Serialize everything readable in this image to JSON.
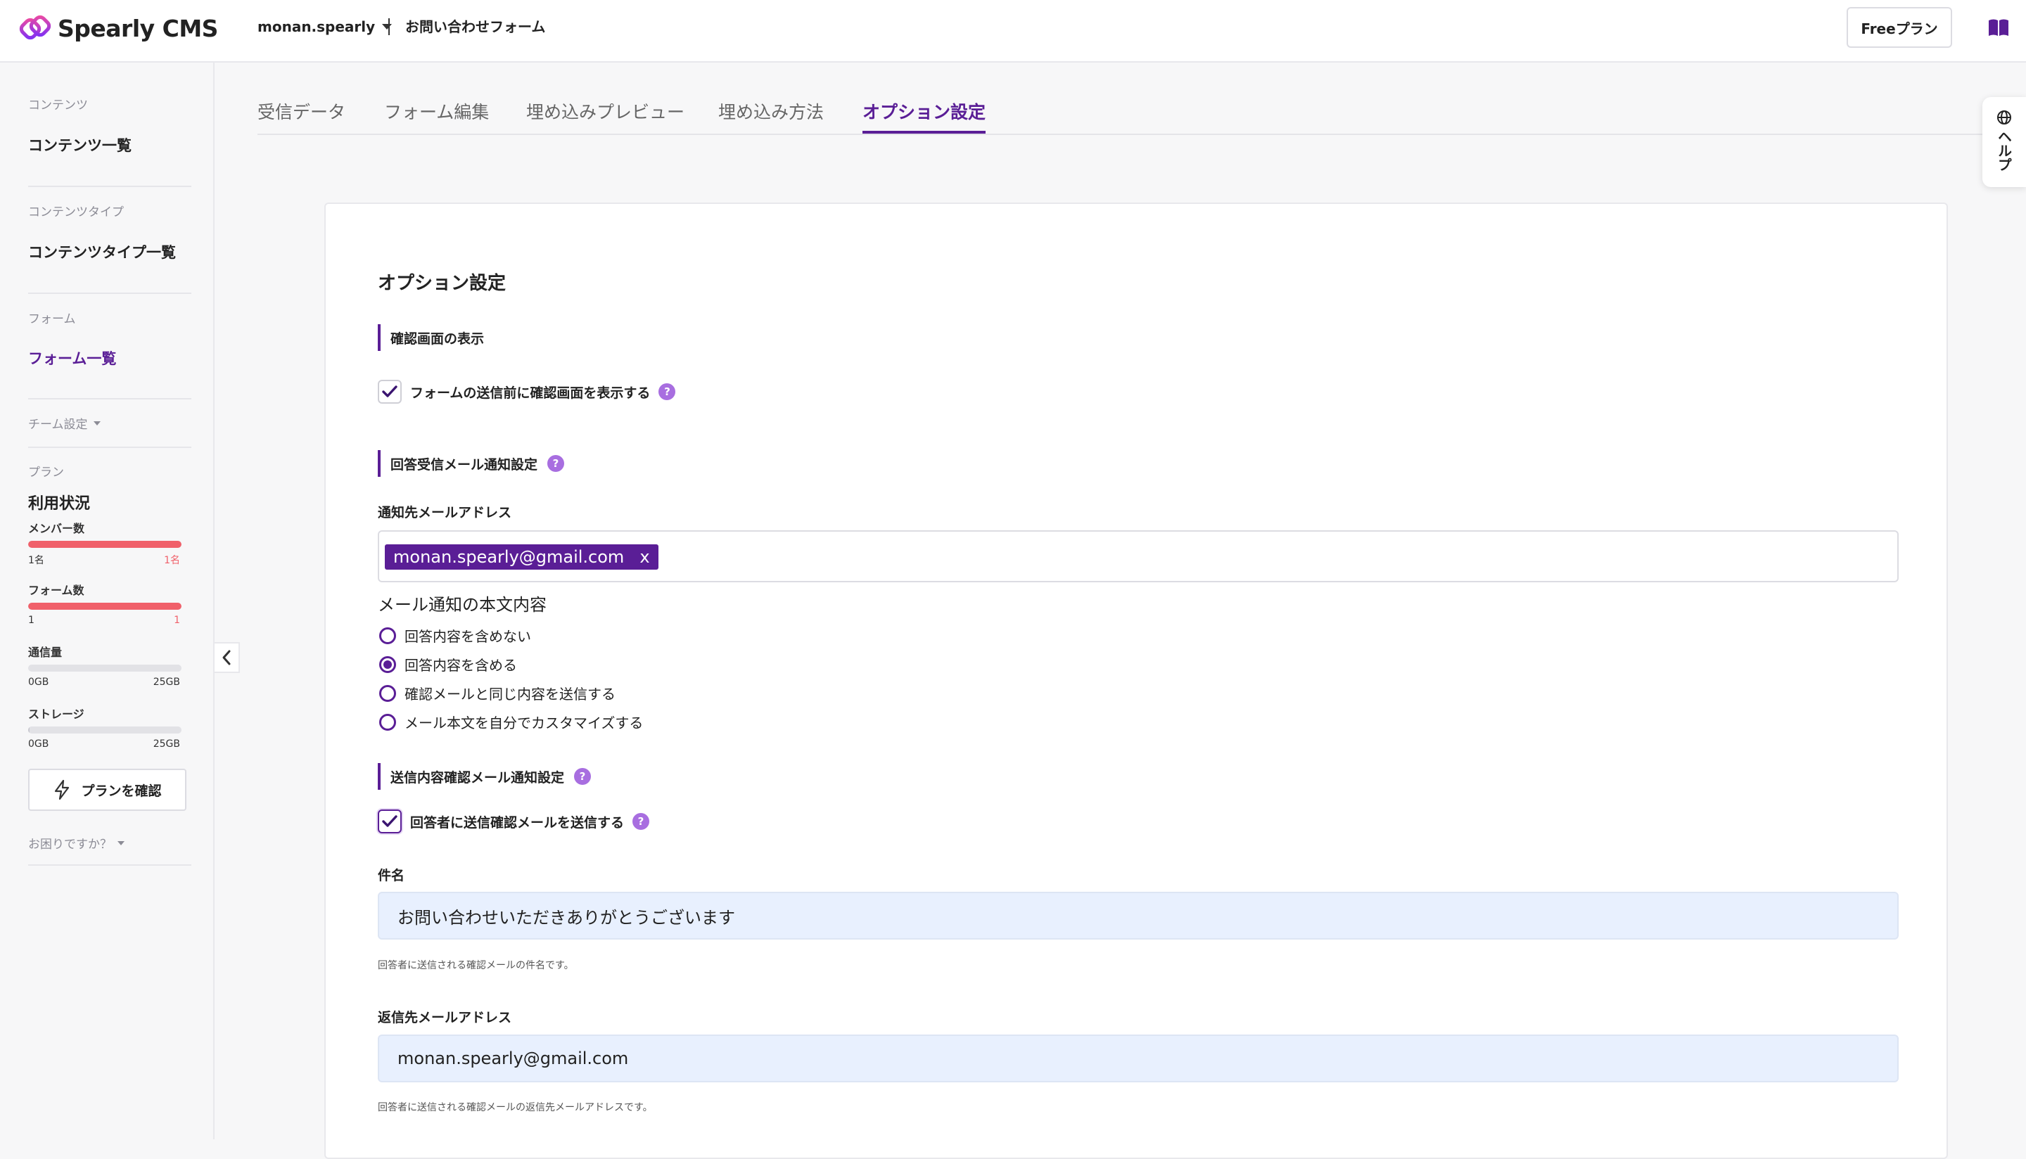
{
  "header": {
    "app_name": "Spearly CMS",
    "team_name": "monan.spearly",
    "form_name": "お問い合わせフォーム",
    "plan_button": "Freeプラン"
  },
  "sidebar": {
    "content_category": "コンテンツ",
    "content_list": "コンテンツ一覧",
    "type_category": "コンテンツタイプ",
    "type_list": "コンテンツタイプ一覧",
    "form_category": "フォーム",
    "form_list": "フォーム一覧",
    "team_settings": "チーム設定",
    "plan_category": "プラン",
    "usage_title": "利用状況",
    "usage": [
      {
        "label": "メンバー数",
        "min": "1名",
        "max": "1名",
        "fill_percent": 100
      },
      {
        "label": "フォーム数",
        "min": "1",
        "max": "1",
        "fill_percent": 100
      },
      {
        "label": "通信量",
        "min": "0GB",
        "max": "25GB",
        "fill_percent": 0
      },
      {
        "label": "ストレージ",
        "min": "0GB",
        "max": "25GB",
        "fill_percent": 1
      }
    ],
    "plan_check_button": "プランを確認",
    "help_dropdown": "お困りですか？"
  },
  "tabs": [
    {
      "label": "受信データ",
      "active": false
    },
    {
      "label": "フォーム編集",
      "active": false
    },
    {
      "label": "埋め込みプレビュー",
      "active": false
    },
    {
      "label": "埋め込み方法",
      "active": false
    },
    {
      "label": "オプション設定",
      "active": true
    }
  ],
  "help_tab": "ヘルプ",
  "card": {
    "title": "オプション設定",
    "confirm_section": {
      "heading": "確認画面の表示",
      "checkbox_label": "フォームの送信前に確認画面を表示する",
      "checked": true
    },
    "notify_section": {
      "heading": "回答受信メール通知設定",
      "address_label": "通知先メールアドレス",
      "tags": [
        "monan.spearly@gmail.com"
      ],
      "tag_remove": "x",
      "body_label": "メール通知の本文内容",
      "options": [
        {
          "label": "回答内容を含めない",
          "selected": false
        },
        {
          "label": "回答内容を含める",
          "selected": true
        },
        {
          "label": "確認メールと同じ内容を送信する",
          "selected": false
        },
        {
          "label": "メール本文を自分でカスタマイズする",
          "selected": false
        }
      ]
    },
    "confirm_mail_section": {
      "heading": "送信内容確認メール通知設定",
      "checkbox_label": "回答者に送信確認メールを送信する",
      "checked": true,
      "subject_label": "件名",
      "subject_value": "お問い合わせいただきありがとうございます",
      "subject_hint": "回答者に送信される確認メールの件名です。",
      "reply_label": "返信先メールアドレス",
      "reply_value": "monan.spearly@gmail.com",
      "reply_hint": "回答者に送信される確認メールの返信先メールアドレスです。"
    }
  },
  "colors": {
    "accent": "#5a1e96",
    "usage_bar": "#f0606a",
    "help_mark": "#a86ee0",
    "input_fill": "#e8f0fe"
  }
}
